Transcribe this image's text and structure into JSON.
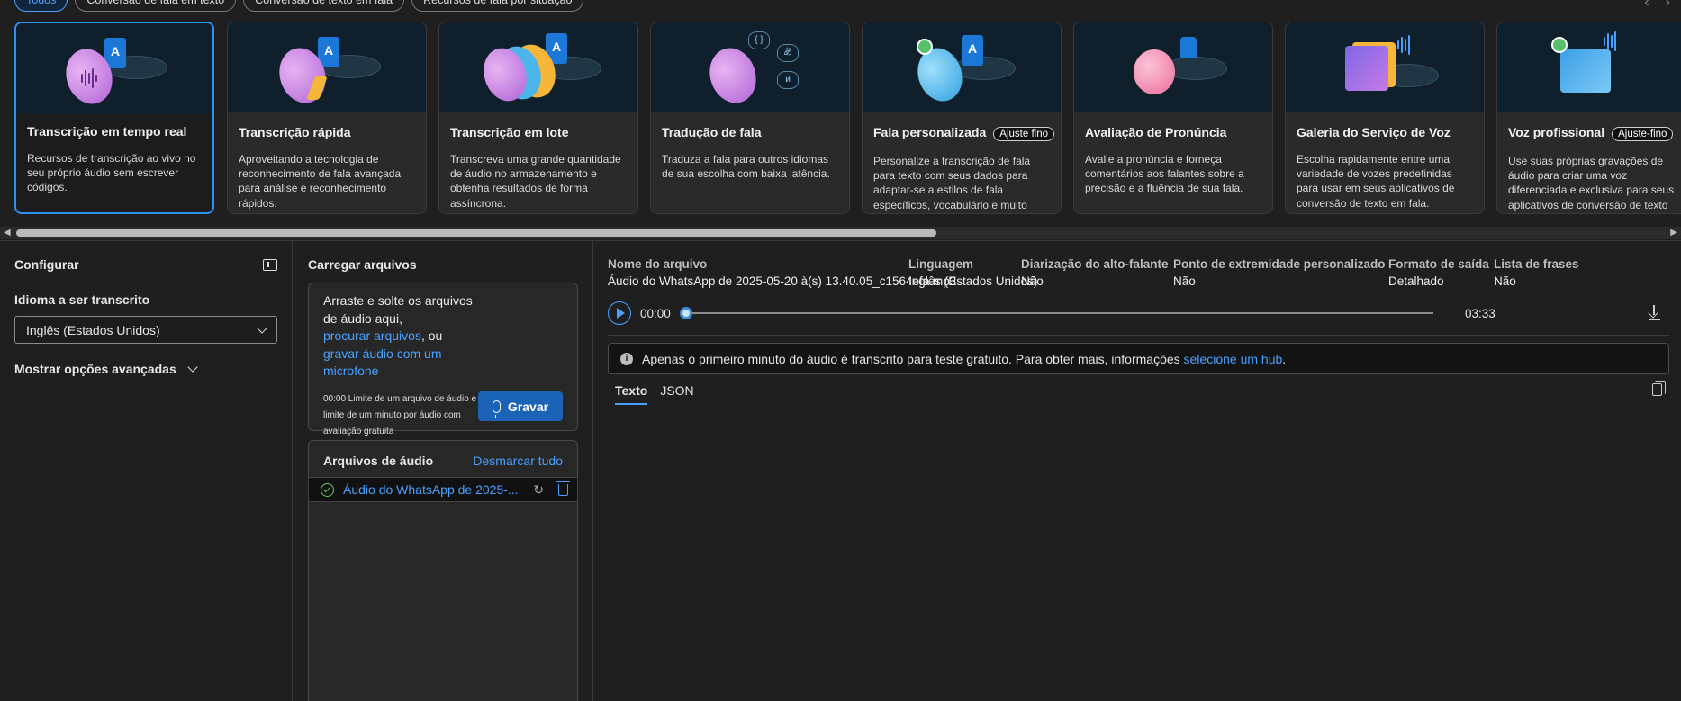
{
  "filters": {
    "pills": [
      {
        "label": "Todos"
      },
      {
        "label": "Conversão de fala em texto"
      },
      {
        "label": "Conversão de texto em fala"
      },
      {
        "label": "Recursos de fala por situação"
      }
    ]
  },
  "cards": [
    {
      "title": "Transcrição em tempo real",
      "desc": "Recursos de transcrição ao vivo no seu próprio áudio sem escrever códigos."
    },
    {
      "title": "Transcrição rápida",
      "desc": "Aproveitando a tecnologia de reconhecimento de fala avançada para análise e reconhecimento rápidos."
    },
    {
      "title": "Transcrição em lote",
      "desc": "Transcreva uma grande quantidade de áudio no armazenamento e obtenha resultados de forma assíncrona."
    },
    {
      "title": "Tradução de fala",
      "desc": "Traduza a fala para outros idiomas de sua escolha com baixa latência."
    },
    {
      "title": "Fala personalizada",
      "badge": "Ajuste fino",
      "desc": "Personalize a transcrição de fala para texto com seus dados para adaptar-se a estilos de fala específicos, vocabulário e muito mais."
    },
    {
      "title": "Avaliação de Pronúncia",
      "desc": "Avalie a pronúncia e forneça comentários aos falantes sobre a precisão e a fluência de sua fala."
    },
    {
      "title": "Galeria do Serviço de Voz",
      "desc": "Escolha rapidamente entre uma variedade de vozes predefinidas para usar em seus aplicativos de conversão de texto em fala."
    },
    {
      "title": "Voz profissional",
      "badge": "Ajuste-fino",
      "desc": "Use suas próprias gravações de áudio para criar uma voz diferenciada e exclusiva para seus aplicativos de conversão de texto em fala."
    }
  ],
  "configure": {
    "title": "Configurar",
    "language_label": "Idioma a ser transcrito",
    "language_value": "Inglês (Estados Unidos)",
    "advanced_label": "Mostrar opções avançadas"
  },
  "upload": {
    "title": "Carregar arquivos",
    "drop_text": "Arraste e solte os arquivos de áudio aqui,",
    "browse_link": "procurar arquivos",
    "or_text": ", ou",
    "record_link": "gravar áudio com um microfone",
    "limit_text": "00:00 Limite de um arquivo de áudio e limite de um minuto por áudio com avaliação gratuita",
    "record_button": "Gravar",
    "files_title": "Arquivos de áudio",
    "deselect_all": "Desmarcar tudo",
    "file_name": "Áudio do WhatsApp de 2025-..."
  },
  "result": {
    "columns": [
      {
        "header": "Nome do arquivo",
        "value": "Áudio do WhatsApp de 2025-05-20 à(s) 13.40.05_c1564efa.mp3"
      },
      {
        "header": "Linguagem",
        "value": "Inglês (Estados Unidos)"
      },
      {
        "header": "Diarização do alto-falante",
        "value": "Não"
      },
      {
        "header": "Ponto de extremidade personalizado",
        "value": "Não"
      },
      {
        "header": "Formato de saída",
        "value": "Detalhado"
      },
      {
        "header": "Lista de frases",
        "value": "Não"
      }
    ],
    "time_current": "00:00",
    "time_total": "03:33",
    "notice_text": "Apenas o primeiro minuto do áudio é transcrito para teste gratuito. Para obter mais, informações",
    "notice_link": "selecione um hub",
    "notice_end": ".",
    "tabs": [
      {
        "label": "Texto"
      },
      {
        "label": "JSON"
      }
    ]
  },
  "colors": {
    "accent": "#4aa0ff",
    "record_button": "#1b63b7",
    "success": "#6ccb5f"
  }
}
